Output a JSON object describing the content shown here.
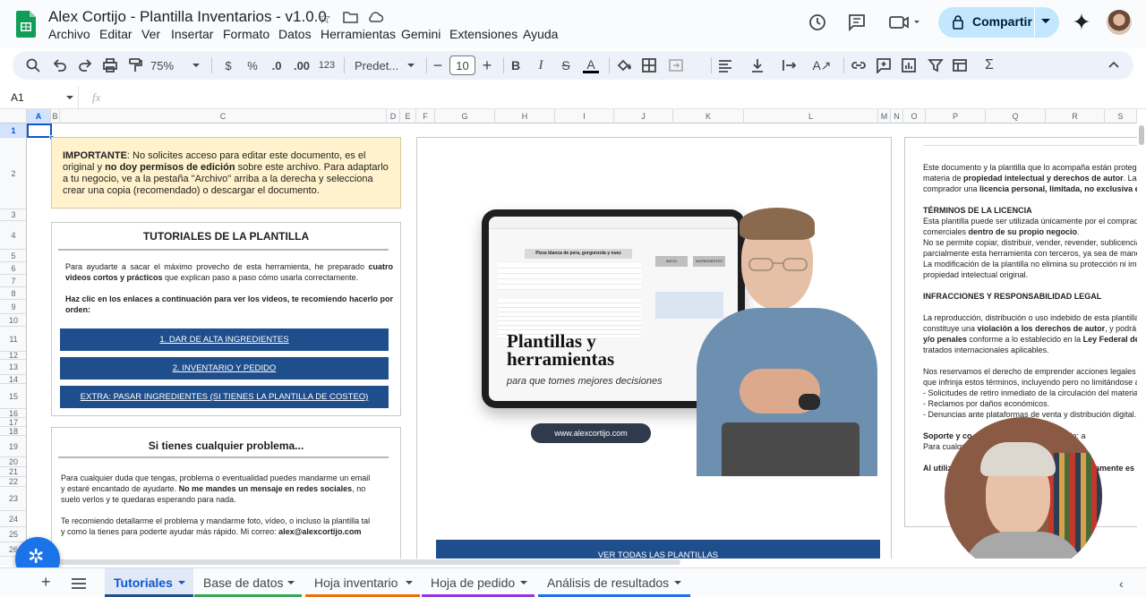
{
  "app": {
    "doc_title": "Alex Cortijo - Plantilla Inventarios - v1.0.0",
    "share_label": "Compartir"
  },
  "menus": [
    "Archivo",
    "Editar",
    "Ver",
    "Insertar",
    "Formato",
    "Datos",
    "Herramientas",
    "Gemini",
    "Extensiones",
    "Ayuda"
  ],
  "toolbar": {
    "zoom": "75%",
    "currency": "$",
    "percent": "%",
    "dec_less": ".0",
    "dec_more": ".00",
    "number_format": "123",
    "font": "Predet...",
    "font_size": "10"
  },
  "formula_bar": {
    "cell_ref": "A1",
    "fx": "fx",
    "value": ""
  },
  "columns": [
    "A",
    "B",
    "C",
    "D",
    "E",
    "F",
    "G",
    "H",
    "I",
    "J",
    "K",
    "L",
    "M",
    "N",
    "O",
    "P",
    "Q",
    "R",
    "S"
  ],
  "rows": [
    "1",
    "2",
    "3",
    "4",
    "5",
    "6",
    "7",
    "8",
    "9",
    "10",
    "11",
    "12",
    "13",
    "14",
    "15",
    "16",
    "17",
    "18",
    "19",
    "20",
    "21",
    "22",
    "23",
    "24",
    "25",
    "26"
  ],
  "notice": {
    "bold1": "IMPORTANTE",
    "t1": ": No solicites acceso para editar este documento, es el original y ",
    "bold2": "no doy permisos de edición",
    "t2": " sobre este archivo. Para adaptarlo a tu negocio, ve a la pestaña \"Archivo\" arriba a la derecha y selecciona crear una copia (recomendado) o descargar el documento."
  },
  "tutorials": {
    "title": "TUTORIALES DE LA PLANTILLA",
    "p1a": "Para ayudarte a sacar el máximo provecho de esta herramienta, he preparado ",
    "p1b": "cuatro videos cortos y prácticos",
    "p1c": " que explican paso a paso cómo usarla correctamente.",
    "p2": "Haz clic en los enlaces a continuación para ver los videos, te recomiendo hacerlo por orden:",
    "links": [
      "1. DAR DE ALTA INGREDIENTES",
      "2. INVENTARIO Y PEDIDO",
      "EXTRA: PASAR INGREDIENTES (SI TIENES LA PLANTILLA DE COSTEO)"
    ]
  },
  "problem": {
    "title": "Si tienes cualquier problema...",
    "p1a": "Para cualquier duda que tengas, problema o eventualidad puedes mandarme un email y estaré encantado de ayudarte. ",
    "p1b": "No me mandes un mensaje en redes sociales",
    "p1c": ", no suelo verlos y te quedaras esperando para nada.",
    "p2a": "Te recomiendo detallarme el problema y mandarme foto, vídeo, o incluso la plantilla tal y como la tienes para poderte ayudar más rápido. Mi correo: ",
    "p2b": "alex@alexcortijo.com"
  },
  "promo": {
    "title1": "Plantillas y",
    "title2": "herramientas",
    "subtitle": "para que tomes mejores decisiones",
    "url": "www.alexcortijo.com",
    "button": "VER TODAS LAS PLANTILLAS",
    "mini_title": "Pizza blanca de pera, gorgonzola y nuez",
    "mini_btn1": "INICIO",
    "mini_btn2": "INGREDIENTES"
  },
  "legal": {
    "p1a": "Este documento y la plantilla que lo acompaña están protegid",
    "p1b": "materia de ",
    "p1c": "propiedad intelectual y derechos de autor",
    "p1d": ". La ac",
    "p1e": "comprador una ",
    "p1f": "licencia personal, limitada, no exclusiva e in",
    "h1": "TÉRMINOS DE LA LICENCIA",
    "l1": "Esta plantilla puede ser utilizada únicamente por el comprador",
    "l2a": "comerciales ",
    "l2b": "dentro de su propio negocio",
    "l2c": ".",
    "l3": "No se permite copiar, distribuir, vender, revender, sublicenciar,",
    "l4": "parcialmente esta herramienta con terceros, ya sea de manera",
    "l5": "La modificación de la plantilla no elimina su protección ni impli",
    "l6": "propiedad intelectual original.",
    "h2": "INFRACCIONES Y RESPONSABILIDAD LEGAL",
    "m1": "La reproducción, distribución o uso indebido de esta plantilla s",
    "m2a": "constituye una ",
    "m2b": "violación a los derechos de autor",
    "m2c": ", y podrá da",
    "m3a": "y/o penales",
    "m3b": " conforme a lo establecido en la ",
    "m3c": "Ley Federal del",
    "m4": "tratados internacionales aplicables.",
    "n1": "Nos reservamos el derecho de emprender acciones legales co",
    "n2": "que infrinja estos términos, incluyendo pero no limitándose a:",
    "n3": "- Solicitudes de retiro inmediato de la circulación del material d",
    "n4": "- Reclamos por daños económicos.",
    "n5": "- Denuncias ante plataformas de venta y distribución digital.",
    "s1": "Soporte y co",
    "s1b": "so extendido: a",
    "s2": "Para cualqu",
    "s3": "Al utiliz",
    "s3b": "esamente es"
  },
  "sheet_tabs": [
    {
      "label": "Tutoriales",
      "active": true,
      "color": "#1f4e8c"
    },
    {
      "label": "Base de datos",
      "active": false,
      "color": "#34a853"
    },
    {
      "label": "Hoja inventario",
      "active": false,
      "color": "#e8710a"
    },
    {
      "label": "Hoja de pedido",
      "active": false,
      "color": "#9334e6"
    },
    {
      "label": "Análisis de resultados",
      "active": false,
      "color": "#1a73e8"
    }
  ],
  "colors": {
    "accent": "#1f4e8c",
    "notice_bg": "#fff2cc",
    "share_bg": "#c2e7ff",
    "sheets_green": "#0f9d58"
  }
}
